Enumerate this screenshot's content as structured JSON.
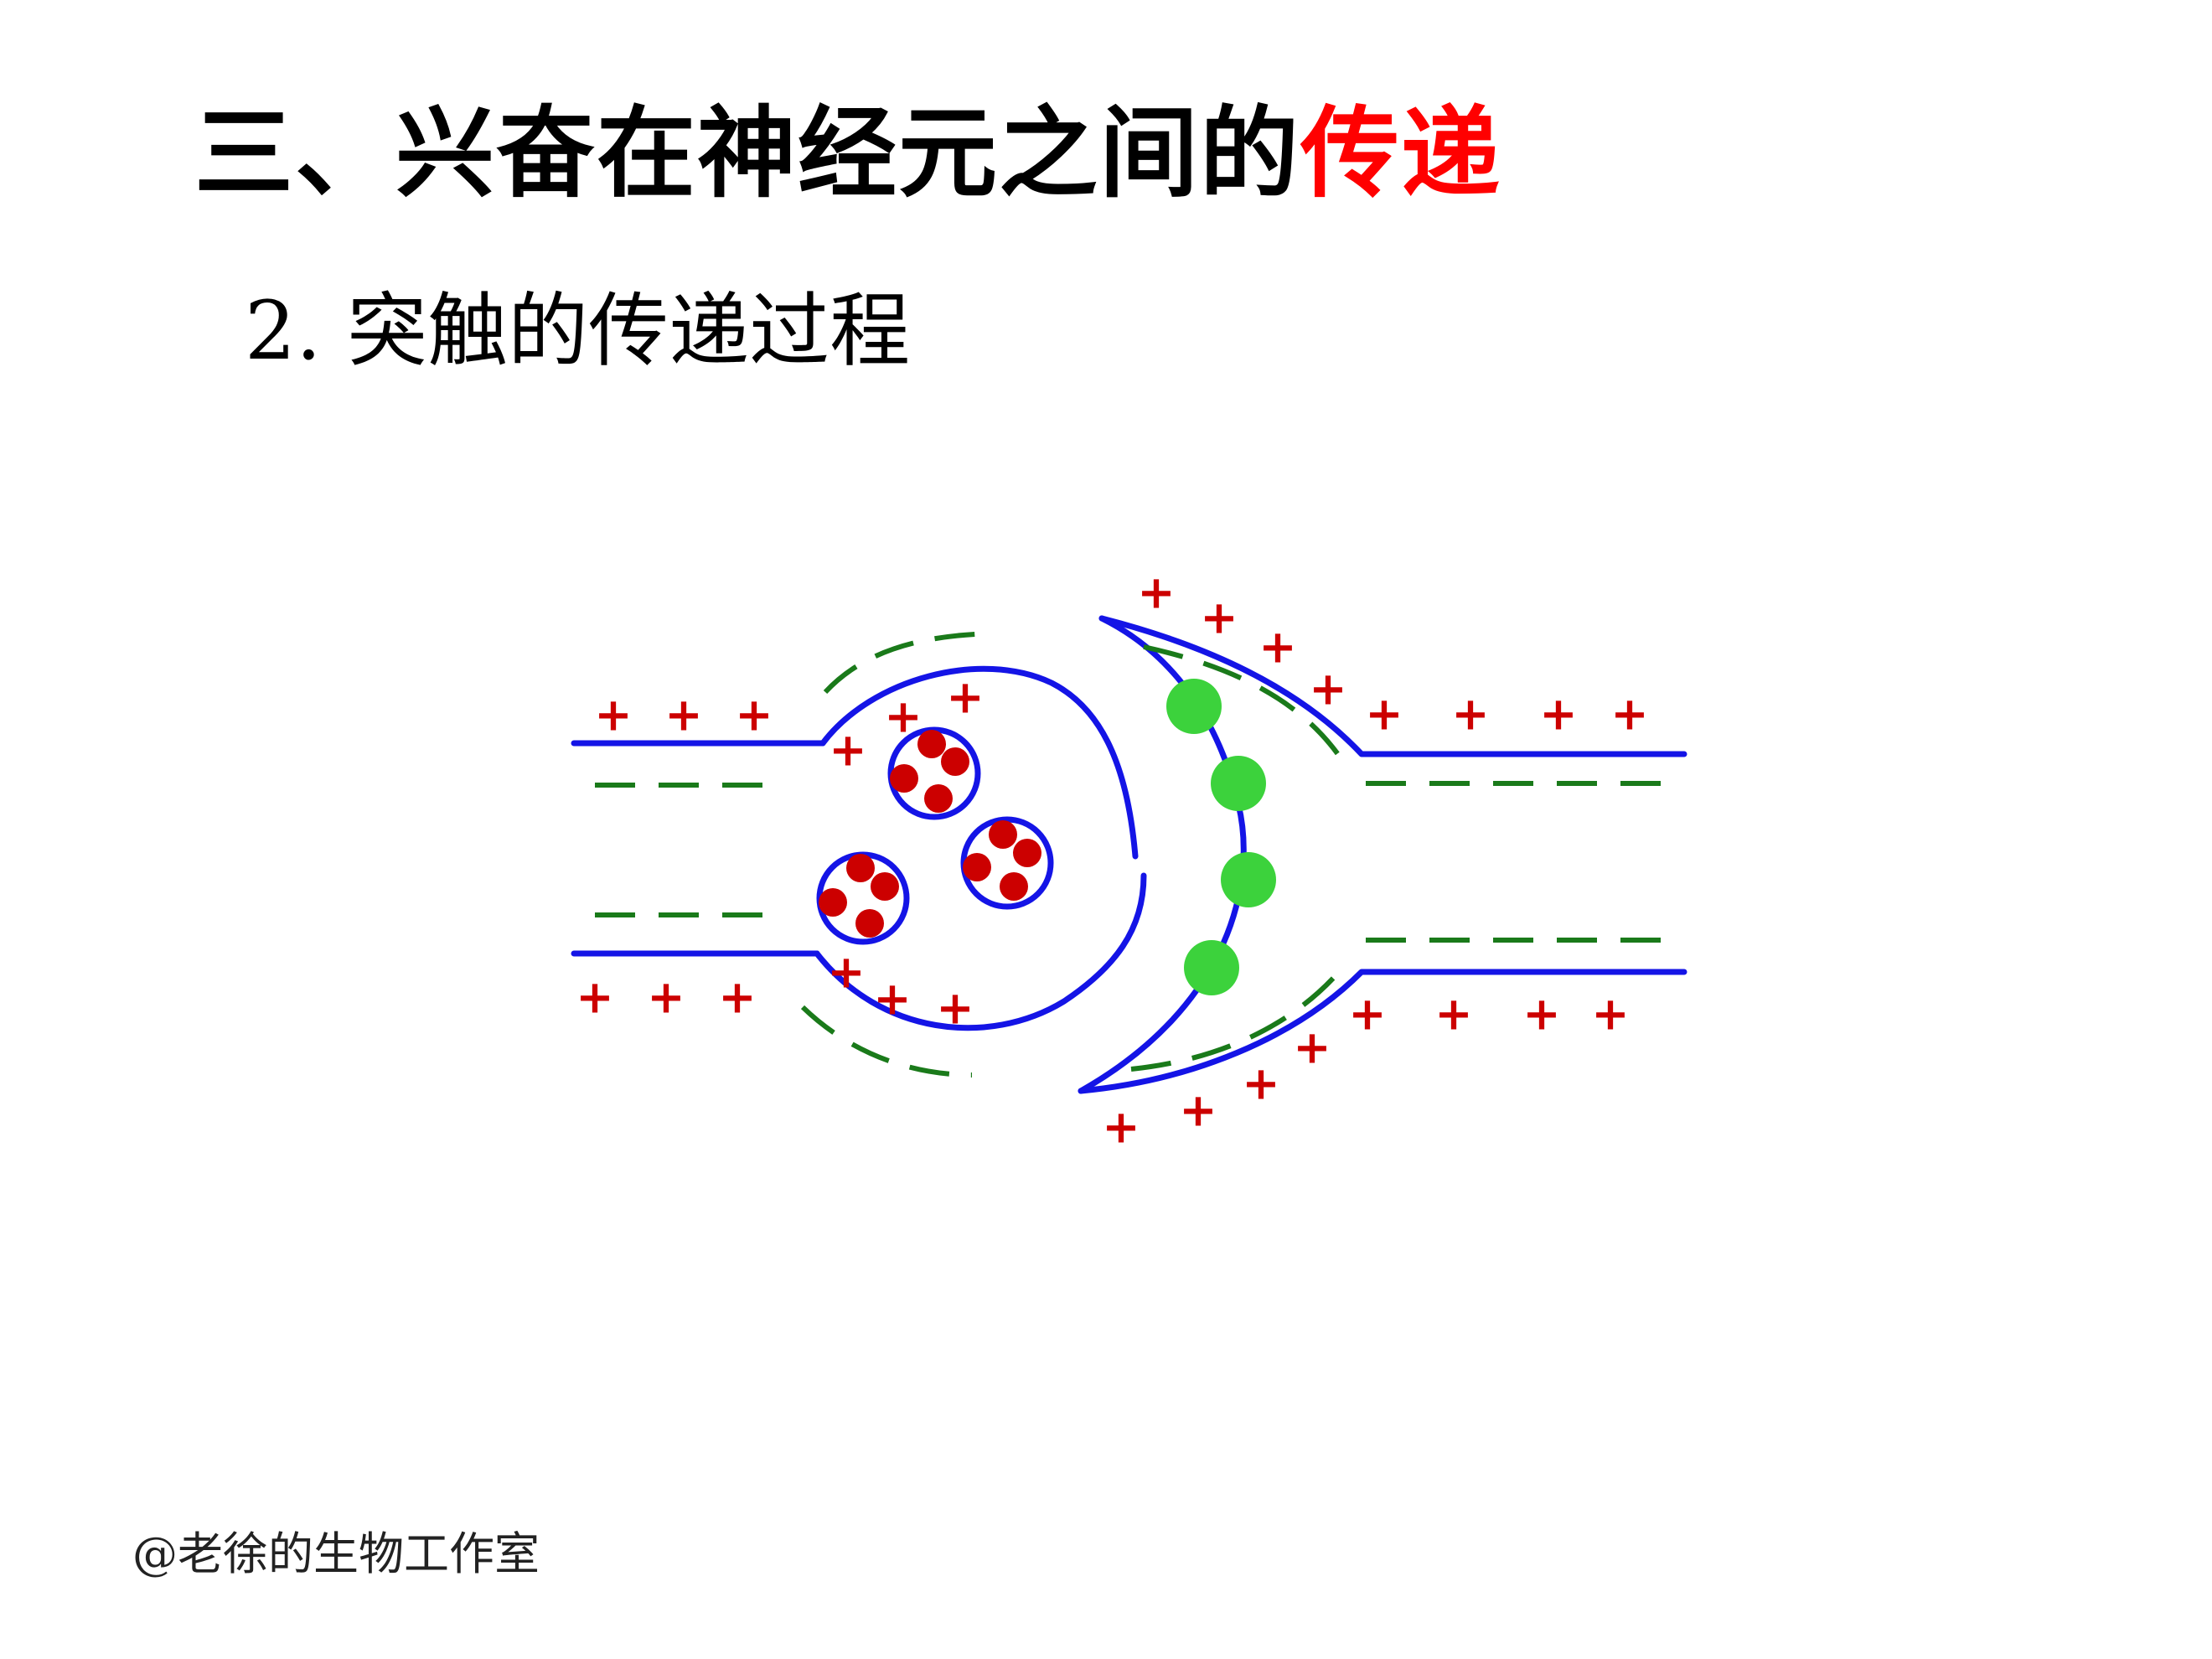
{
  "slide": {
    "title_prefix": "三、兴奋在神经元之间的",
    "title_highlight": "传递",
    "subtitle": "2. 突触的传递过程"
  },
  "diagram": {
    "charge_plus": "+",
    "colors": {
      "membrane": "#1414e6",
      "inside_charge": "#1a7a1a",
      "positive_charge": "#cc0000",
      "vesicle_contents": "#cc0000",
      "receptor": "#3cd23c",
      "highlight": "#ff0000"
    }
  },
  "watermark": "@老徐的生物工作室"
}
